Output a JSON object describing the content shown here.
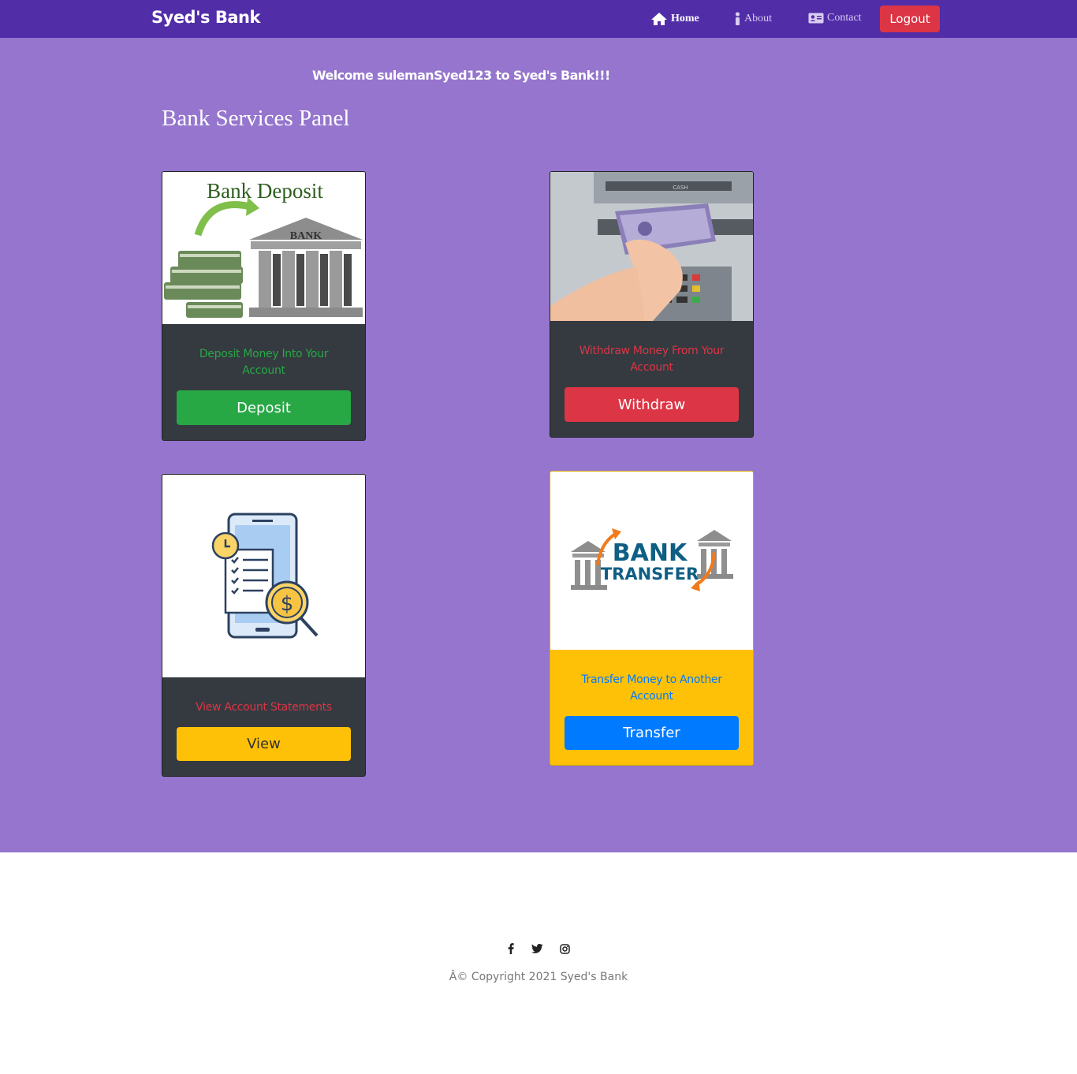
{
  "navbar": {
    "brand": "Syed's Bank",
    "links": [
      {
        "label": "Home",
        "icon": "home-icon"
      },
      {
        "label": "About",
        "icon": "info-icon"
      },
      {
        "label": "Contact",
        "icon": "contact-card-icon"
      }
    ],
    "logout_label": "Logout"
  },
  "main": {
    "welcome": "Welcome sulemanSyed123 to Syed's Bank!!!",
    "panel_title": "Bank Services Panel"
  },
  "cards": {
    "deposit": {
      "image_text_title": "Bank Deposit",
      "image_text_bank": "BANK",
      "description": "Deposit Money Into Your Account",
      "button": "Deposit",
      "colors": {
        "description": "#28a745",
        "button": "#28a745"
      }
    },
    "withdraw": {
      "image_text_cash": "CASH",
      "description": "Withdraw Money From Your Account",
      "button": "Withdraw",
      "colors": {
        "description": "#dc3545",
        "button": "#dc3545"
      }
    },
    "statements": {
      "description": "View Account Statements",
      "button": "View",
      "colors": {
        "description": "#dc3545",
        "button": "#ffc107"
      }
    },
    "transfer": {
      "image_text_line1": "BANK",
      "image_text_line2": "TRANSFER",
      "description": "Transfer Money to Another Account",
      "button": "Transfer",
      "colors": {
        "description": "#007bff",
        "button": "#007bff",
        "background": "#ffc107"
      }
    }
  },
  "footer": {
    "social_icons": [
      "facebook-icon",
      "twitter-icon",
      "instagram-icon"
    ],
    "copyright": "Â© Copyright 2021 Syed's Bank"
  },
  "colors": {
    "navbar": "#512da8",
    "page": "#9575cd",
    "card_dark": "#343a40"
  }
}
